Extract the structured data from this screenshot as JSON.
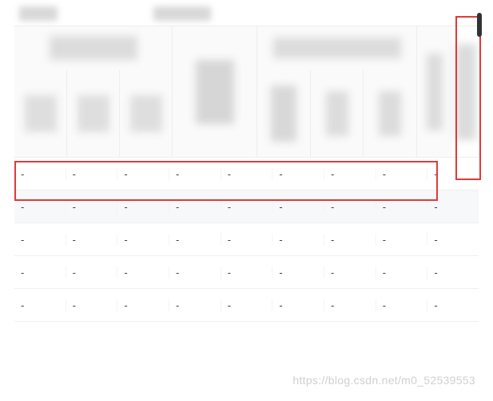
{
  "header": {
    "block1": "",
    "block2": ""
  },
  "table": {
    "rows": [
      {
        "alt": false,
        "cells": [
          "-",
          "-",
          "-",
          "-",
          "-",
          "-",
          "-",
          "-",
          "-"
        ]
      },
      {
        "alt": true,
        "cells": [
          "-",
          "-",
          "-",
          "-",
          "-",
          "-",
          "-",
          "-",
          "-"
        ]
      },
      {
        "alt": false,
        "cells": [
          "-",
          "-",
          "-",
          "-",
          "-",
          "-",
          "-",
          "-",
          "-"
        ]
      },
      {
        "alt": false,
        "cells": [
          "-",
          "-",
          "-",
          "-",
          "-",
          "-",
          "-",
          "-",
          "-"
        ]
      },
      {
        "alt": false,
        "cells": [
          "-",
          "-",
          "-",
          "-",
          "-",
          "-",
          "-",
          "-",
          "-"
        ]
      }
    ]
  },
  "watermark": "https://blog.csdn.net/m0_52539553"
}
